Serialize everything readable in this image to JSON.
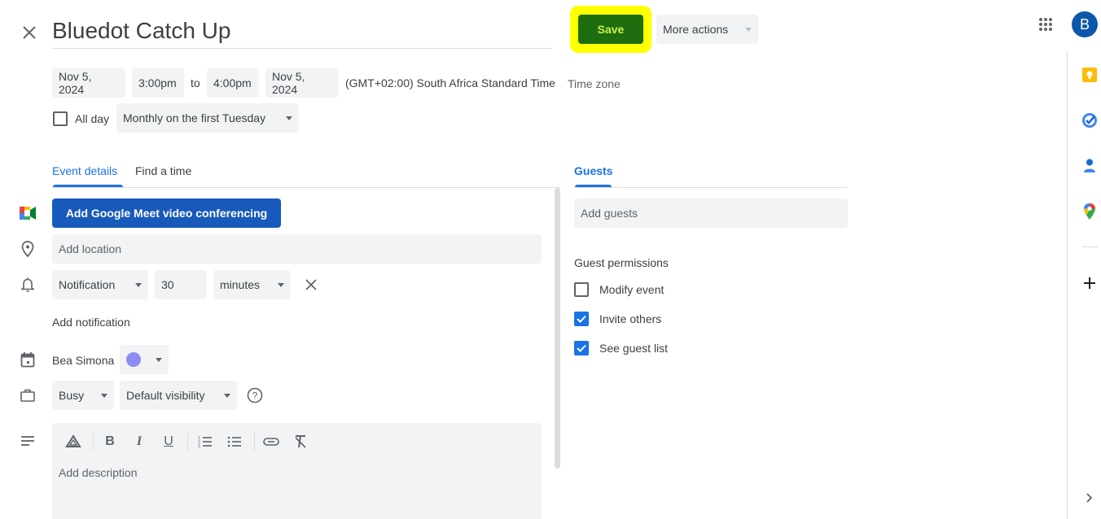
{
  "header": {
    "title": "Bluedot Catch Up",
    "save_label": "Save",
    "more_actions_label": "More actions",
    "avatar_letter": "B",
    "save_highlight_color": "#ffff00",
    "save_button_color": "#1e6e10",
    "save_text_color": "#c6f24a"
  },
  "datetime": {
    "start_date": "Nov 5, 2024",
    "start_time": "3:00pm",
    "to_label": "to",
    "end_time": "4:00pm",
    "end_date": "Nov 5, 2024",
    "timezone_text": "(GMT+02:00) South Africa Standard Time",
    "timezone_link": "Time zone",
    "all_day_label": "All day",
    "all_day_checked": false,
    "recurrence": "Monthly on the first Tuesday"
  },
  "tabs": [
    {
      "label": "Event details",
      "active": true
    },
    {
      "label": "Find a time",
      "active": false
    }
  ],
  "details": {
    "meet_button_label": "Add Google Meet video conferencing",
    "location_placeholder": "Add location",
    "notification_type": "Notification",
    "notification_value": "30",
    "notification_unit": "minutes",
    "add_notification_label": "Add notification",
    "calendar_owner": "Bea Simona",
    "calendar_color": "#8e8cf0",
    "availability": "Busy",
    "visibility": "Default visibility",
    "description_placeholder": "Add description",
    "toolbar": [
      "drive-attachment",
      "bold",
      "italic",
      "underline",
      "numbered-list",
      "bulleted-list",
      "link",
      "remove-formatting"
    ]
  },
  "guests": {
    "tab_label": "Guests",
    "add_guests_placeholder": "Add guests",
    "permissions_title": "Guest permissions",
    "permissions": [
      {
        "label": "Modify event",
        "checked": false
      },
      {
        "label": "Invite others",
        "checked": true
      },
      {
        "label": "See guest list",
        "checked": true
      }
    ]
  },
  "side_panel": {
    "items": [
      "keep",
      "tasks",
      "contacts",
      "maps"
    ],
    "add_label": "+",
    "expand_label": ">"
  }
}
